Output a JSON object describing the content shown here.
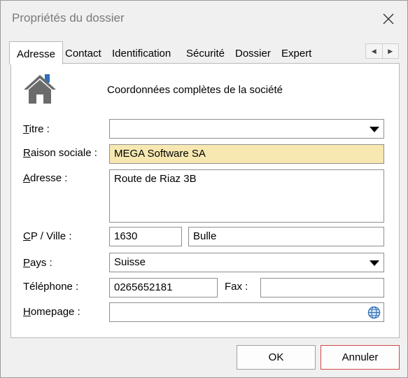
{
  "window": {
    "title": "Propriétés du dossier"
  },
  "tabs": [
    {
      "label": "Adresse",
      "active": true
    },
    {
      "label": "Contact"
    },
    {
      "label": "Identification"
    },
    {
      "label": "Sécurité"
    },
    {
      "label": "Dossier"
    },
    {
      "label": "Expert"
    }
  ],
  "tab_scroll": {
    "left": "◀",
    "right": "▶"
  },
  "panel": {
    "heading": "Coordonnées complètes de la société",
    "icon": "house-icon"
  },
  "form": {
    "titre": {
      "mnemonic": "T",
      "rest": "itre :",
      "value": ""
    },
    "raison_sociale": {
      "mnemonic": "R",
      "rest": "aison sociale :",
      "value": "MEGA Software SA"
    },
    "adresse": {
      "mnemonic": "A",
      "rest": "dresse :",
      "value": "Route de Riaz 3B"
    },
    "cp_ville": {
      "mnemonic": "C",
      "rest": "P / Ville :",
      "cp": "1630",
      "ville": "Bulle"
    },
    "pays": {
      "mnemonic": "P",
      "rest": "ays :",
      "value": "Suisse"
    },
    "telephone": {
      "label": "Téléphone :",
      "value": "0265652181"
    },
    "fax": {
      "label": "Fax :",
      "value": ""
    },
    "homepage": {
      "mnemonic": "H",
      "rest": "omepage :",
      "value": ""
    }
  },
  "buttons": {
    "ok": "OK",
    "cancel": "Annuler"
  },
  "colors": {
    "highlight_field": "#f7e8b2",
    "cancel_border": "#d64545"
  }
}
